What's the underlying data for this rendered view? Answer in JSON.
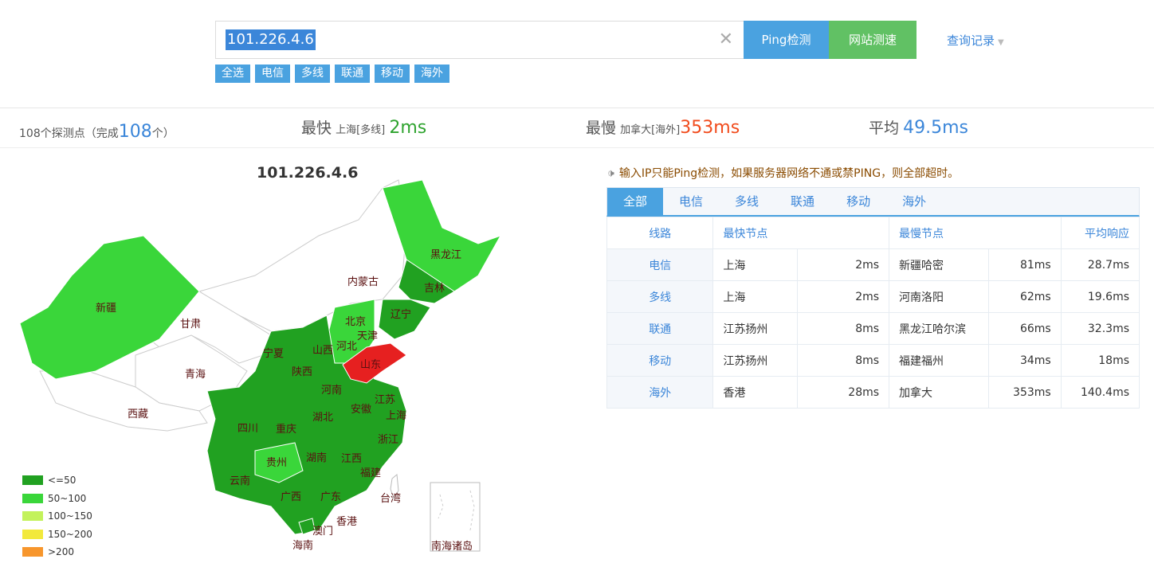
{
  "search": {
    "value": "101.226.4.6",
    "clear_icon": "close-icon",
    "ping_label": "Ping检测",
    "speed_label": "网站测速",
    "history_label": "查询记录"
  },
  "filters": [
    "全选",
    "电信",
    "多线",
    "联通",
    "移动",
    "海外"
  ],
  "stats": {
    "count_prefix": "108个探测点（完成",
    "count_done": "108",
    "count_suffix": "个）",
    "fastest_label": "最快",
    "fastest_node": "上海[多线]",
    "fastest_value": "2ms",
    "slowest_label": "最慢",
    "slowest_node": "加拿大[海外]",
    "slowest_value": "353ms",
    "avg_label": "平均",
    "avg_value": "49.5ms"
  },
  "map": {
    "title": "101.226.4.6",
    "provinces": [
      "新疆",
      "甘肃",
      "青海",
      "西藏",
      "内蒙古",
      "黑龙江",
      "吉林",
      "辽宁",
      "北京",
      "天津",
      "河北",
      "山西",
      "宁夏",
      "陕西",
      "山东",
      "河南",
      "江苏",
      "安徽",
      "上海",
      "湖北",
      "四川",
      "重庆",
      "贵州",
      "湖南",
      "江西",
      "浙江",
      "福建",
      "云南",
      "广西",
      "广东",
      "台湾",
      "香港",
      "澳门",
      "海南",
      "南海诸岛"
    ],
    "colors": {
      "le50": "#21a121",
      "c50_100": "#3ad63a",
      "c100_150": "#c3f25b",
      "c150_200": "#f2e93c",
      "gt200": "#f7962c",
      "highlight": "#e62020"
    },
    "legend": [
      "<=50",
      "50~100",
      "100~150",
      "150~200",
      ">200"
    ]
  },
  "notice": "输入IP只能Ping检测，如果服务器网络不通或禁PING，则全部超时。",
  "tabs": [
    "全部",
    "电信",
    "多线",
    "联通",
    "移动",
    "海外"
  ],
  "table": {
    "headers": {
      "line": "线路",
      "fastest": "最快节点",
      "slowest": "最慢节点",
      "avg": "平均响应"
    },
    "rows": [
      {
        "line": "电信",
        "fast": "上海",
        "fast_ms": "2ms",
        "slow": "新疆哈密",
        "slow_ms": "81ms",
        "avg": "28.7ms"
      },
      {
        "line": "多线",
        "fast": "上海",
        "fast_ms": "2ms",
        "slow": "河南洛阳",
        "slow_ms": "62ms",
        "avg": "19.6ms"
      },
      {
        "line": "联通",
        "fast": "江苏扬州",
        "fast_ms": "8ms",
        "slow": "黑龙江哈尔滨",
        "slow_ms": "66ms",
        "avg": "32.3ms"
      },
      {
        "line": "移动",
        "fast": "江苏扬州",
        "fast_ms": "8ms",
        "slow": "福建福州",
        "slow_ms": "34ms",
        "avg": "18ms"
      },
      {
        "line": "海外",
        "fast": "香港",
        "fast_ms": "28ms",
        "slow": "加拿大",
        "slow_ms": "353ms",
        "avg": "140.4ms"
      }
    ]
  }
}
